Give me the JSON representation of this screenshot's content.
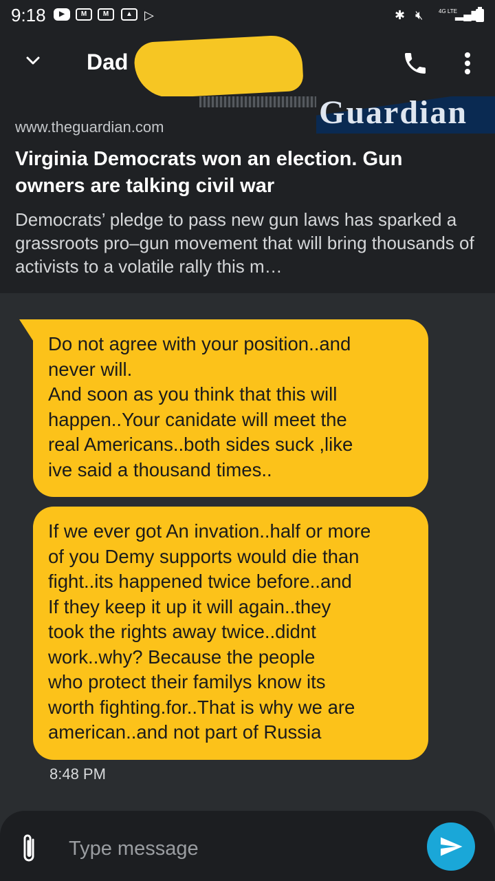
{
  "status_bar": {
    "time": "9:18",
    "network": "4G LTE"
  },
  "header": {
    "title": "Dad ("
  },
  "link_preview": {
    "image_text": "Guardian",
    "domain": "www.theguardian.com",
    "title": "Virginia Democrats won an election. Gun owners are talking civil war",
    "description": "Democrats’ pledge to pass new gun laws has sparked a grassroots pro–gun movement that will bring thousands of activists to a volatile rally this m…"
  },
  "messages": [
    {
      "text": "Do not agree with your position..and\nnever will.\nAnd soon as you think that this will\nhappen..Your canidate will meet the\nreal Americans..both sides suck ,like\nive said a thousand times.."
    },
    {
      "text": "If we ever got An invation..half or more\nof you Demy supports would die than\nfight..its happened twice before..and\nIf they keep it up it will again..they\ntook the rights away twice..didnt\nwork..why? Because the people\nwho protect their familys know its\nworth fighting.for..That is why we are\namerican..and not part of Russia"
    }
  ],
  "timestamp": "8:48 PM",
  "compose": {
    "placeholder": "Type message"
  },
  "colors": {
    "bubble": "#fcc21a",
    "send": "#1aa7d8",
    "background": "#2a2d30",
    "bar": "#1f2124"
  }
}
